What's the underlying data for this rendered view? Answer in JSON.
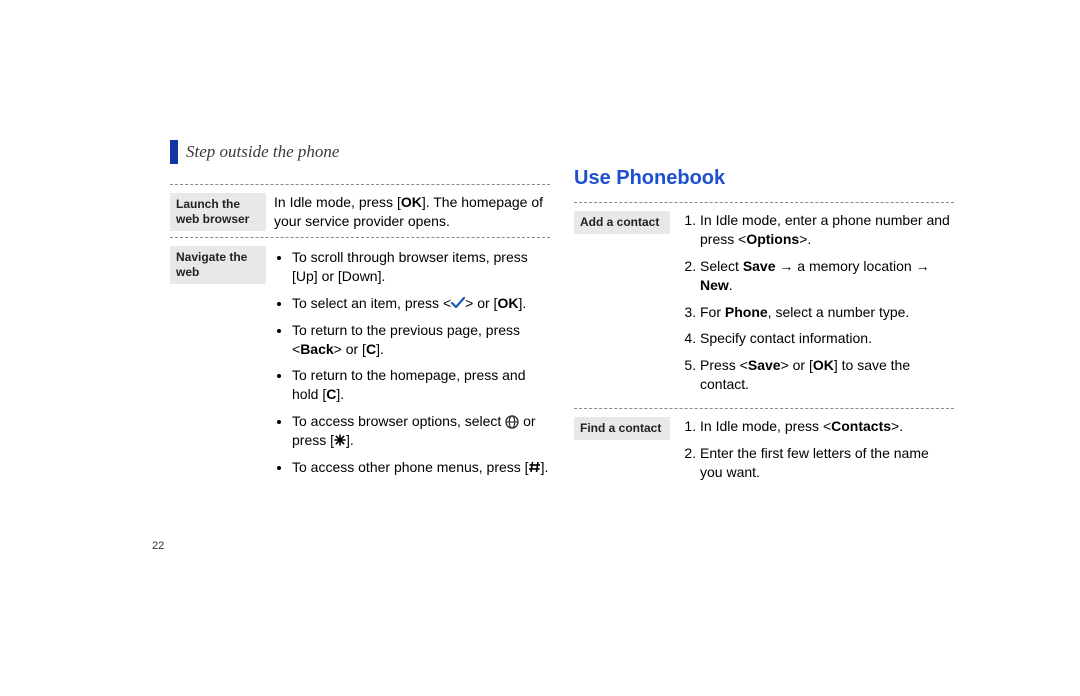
{
  "header": "Step outside the phone",
  "page_number": "22",
  "left": {
    "tag1": "Launch the web browser",
    "body1_pre": "In Idle mode, press [",
    "body1_bold": "OK",
    "body1_post": "]. The homepage of your service provider opens.",
    "tag2": "Navigate the web",
    "b1": "To scroll through browser items, press [Up] or [Down].",
    "b2_pre": "To select an item, press <",
    "b2_post": "> or [",
    "b2_bold": "OK",
    "b2_end": "].",
    "b3_pre": "To return to the previous page, press <",
    "b3_bold1": "Back",
    "b3_mid": "> or [",
    "b3_bold2": "C",
    "b3_end": "].",
    "b4_pre": "To return to the homepage, press and hold [",
    "b4_bold": "C",
    "b4_end": "].",
    "b5_pre": "To access browser options, select ",
    "b5_post": " or press [",
    "b5_end": "].",
    "b6_pre": "To access other phone menus, press [",
    "b6_end": "]."
  },
  "right": {
    "title": "Use Phonebook",
    "tagA": "Add a contact",
    "a1_pre": "In Idle mode, enter a phone number and press <",
    "a1_bold": "Options",
    "a1_end": ">.",
    "a2_pre": "Select ",
    "a2_bold1": "Save",
    "a2_mid1": " → a memory location → ",
    "a2_bold2": "New",
    "a2_end": ".",
    "a3_pre": "For ",
    "a3_bold": "Phone",
    "a3_end": ", select a number type.",
    "a4": "Specify contact information.",
    "a5_pre": "Press <",
    "a5_bold1": "Save",
    "a5_mid": "> or [",
    "a5_bold2": "OK",
    "a5_end": "] to save the contact.",
    "tagB": "Find a contact",
    "b1_pre": "In Idle mode, press <",
    "b1_bold": "Contacts",
    "b1_end": ">.",
    "b2": "Enter the first few letters of the name you want."
  }
}
